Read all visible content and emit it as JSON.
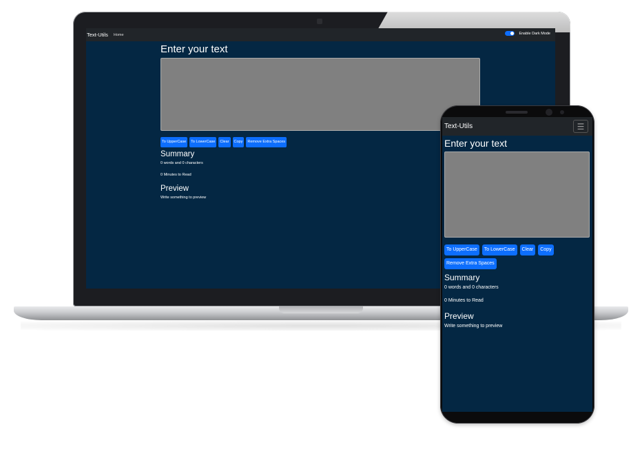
{
  "desktop": {
    "nav": {
      "brand": "Text-Utils",
      "home": "Home",
      "dark_mode_label": "Enable Dark Mode"
    },
    "heading": "Enter your text",
    "buttons": {
      "uppercase": "To UpperCase",
      "lowercase": "To LowerCase",
      "clear": "Clear",
      "copy": "Copy",
      "remove_spaces": "Remove Extra Spaces"
    },
    "summary": {
      "heading": "Summary",
      "counts": "0 words and 0 characters",
      "read_time": "0 Minutes to Read"
    },
    "preview": {
      "heading": "Preview",
      "text": "Write something to preview"
    }
  },
  "mobile": {
    "nav": {
      "brand": "Text-Utils",
      "toggler_glyph": "☰"
    },
    "heading": "Enter your text",
    "buttons": {
      "uppercase": "To UpperCase",
      "lowercase": "To LowerCase",
      "clear": "Clear",
      "copy": "Copy",
      "remove_spaces": "Remove Extra Spaces"
    },
    "summary": {
      "heading": "Summary",
      "counts": "0 words and 0 characters",
      "read_time": "0 Minutes to Read"
    },
    "preview": {
      "heading": "Preview",
      "text": "Write something to preview"
    }
  },
  "colors": {
    "background": "#042743",
    "navbar": "#212529",
    "button": "#0d6efd",
    "textarea": "#808080"
  }
}
